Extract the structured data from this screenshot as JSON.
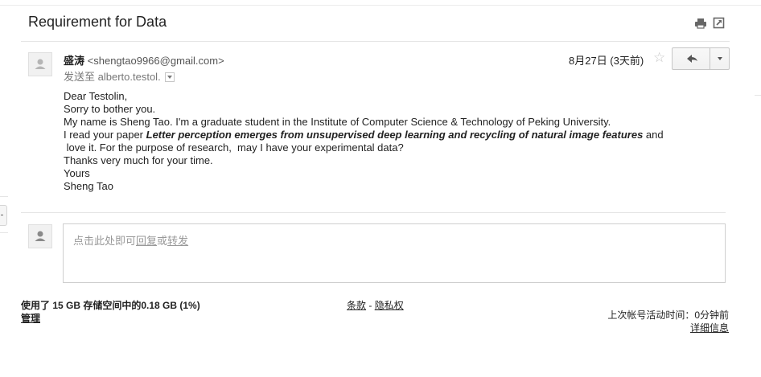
{
  "message": {
    "subject": "Requirement for Data",
    "sender_name": "盛涛",
    "sender_email": "<shengtao9966@gmail.com>",
    "to_prefix": "发送至",
    "to_recipient": "alberto.testol.",
    "date": "8月27日 (3天前)",
    "body": {
      "greeting": "Dear Testolin,",
      "line1": "Sorry to bother you.",
      "line2": "My name is Sheng Tao. I'm a graduate student in the Institute of Computer Science & Technology of Peking University.",
      "line3_prefix": "I read your paper ",
      "paper_title": "Letter perception emerges from unsupervised deep learning and recycling of natural image features",
      "line3_suffix": " and",
      "line4": " love it. For the purpose of research,  may I have your experimental data?",
      "line5": "Thanks very much for your time.",
      "closing": "Yours",
      "signature": "Sheng Tao"
    }
  },
  "icons": {
    "print": "print-icon",
    "new_window": "new-window-icon",
    "star": "star-icon",
    "reply": "reply-icon",
    "more": "chevron-down-icon",
    "avatar": "person-icon"
  },
  "reply_prompt": {
    "prefix": "点击此处即可",
    "reply": "回复",
    "or": "或",
    "forward": "转发"
  },
  "footer": {
    "storage": "使用了 15 GB 存储空间中的0.18 GB (1%)",
    "manage": "管理",
    "terms": "条款",
    "sep": " - ",
    "privacy": "隐私权",
    "last_activity": "上次帐号活动时间：0分钟前",
    "details": "详细信息"
  },
  "colors": {
    "star": "#c6c6c6",
    "border": "#c6c6c6",
    "muted_text": "#777777"
  }
}
